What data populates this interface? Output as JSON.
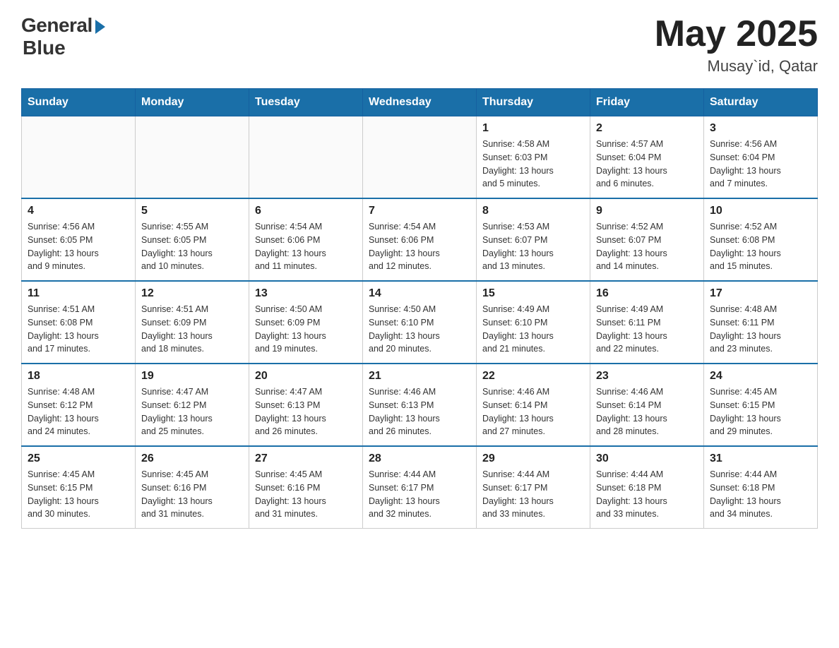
{
  "header": {
    "logo_general": "General",
    "logo_blue": "Blue",
    "main_title": "May 2025",
    "subtitle": "Musay`id, Qatar"
  },
  "days_of_week": [
    "Sunday",
    "Monday",
    "Tuesday",
    "Wednesday",
    "Thursday",
    "Friday",
    "Saturday"
  ],
  "weeks": [
    [
      {
        "num": "",
        "info": ""
      },
      {
        "num": "",
        "info": ""
      },
      {
        "num": "",
        "info": ""
      },
      {
        "num": "",
        "info": ""
      },
      {
        "num": "1",
        "info": "Sunrise: 4:58 AM\nSunset: 6:03 PM\nDaylight: 13 hours\nand 5 minutes."
      },
      {
        "num": "2",
        "info": "Sunrise: 4:57 AM\nSunset: 6:04 PM\nDaylight: 13 hours\nand 6 minutes."
      },
      {
        "num": "3",
        "info": "Sunrise: 4:56 AM\nSunset: 6:04 PM\nDaylight: 13 hours\nand 7 minutes."
      }
    ],
    [
      {
        "num": "4",
        "info": "Sunrise: 4:56 AM\nSunset: 6:05 PM\nDaylight: 13 hours\nand 9 minutes."
      },
      {
        "num": "5",
        "info": "Sunrise: 4:55 AM\nSunset: 6:05 PM\nDaylight: 13 hours\nand 10 minutes."
      },
      {
        "num": "6",
        "info": "Sunrise: 4:54 AM\nSunset: 6:06 PM\nDaylight: 13 hours\nand 11 minutes."
      },
      {
        "num": "7",
        "info": "Sunrise: 4:54 AM\nSunset: 6:06 PM\nDaylight: 13 hours\nand 12 minutes."
      },
      {
        "num": "8",
        "info": "Sunrise: 4:53 AM\nSunset: 6:07 PM\nDaylight: 13 hours\nand 13 minutes."
      },
      {
        "num": "9",
        "info": "Sunrise: 4:52 AM\nSunset: 6:07 PM\nDaylight: 13 hours\nand 14 minutes."
      },
      {
        "num": "10",
        "info": "Sunrise: 4:52 AM\nSunset: 6:08 PM\nDaylight: 13 hours\nand 15 minutes."
      }
    ],
    [
      {
        "num": "11",
        "info": "Sunrise: 4:51 AM\nSunset: 6:08 PM\nDaylight: 13 hours\nand 17 minutes."
      },
      {
        "num": "12",
        "info": "Sunrise: 4:51 AM\nSunset: 6:09 PM\nDaylight: 13 hours\nand 18 minutes."
      },
      {
        "num": "13",
        "info": "Sunrise: 4:50 AM\nSunset: 6:09 PM\nDaylight: 13 hours\nand 19 minutes."
      },
      {
        "num": "14",
        "info": "Sunrise: 4:50 AM\nSunset: 6:10 PM\nDaylight: 13 hours\nand 20 minutes."
      },
      {
        "num": "15",
        "info": "Sunrise: 4:49 AM\nSunset: 6:10 PM\nDaylight: 13 hours\nand 21 minutes."
      },
      {
        "num": "16",
        "info": "Sunrise: 4:49 AM\nSunset: 6:11 PM\nDaylight: 13 hours\nand 22 minutes."
      },
      {
        "num": "17",
        "info": "Sunrise: 4:48 AM\nSunset: 6:11 PM\nDaylight: 13 hours\nand 23 minutes."
      }
    ],
    [
      {
        "num": "18",
        "info": "Sunrise: 4:48 AM\nSunset: 6:12 PM\nDaylight: 13 hours\nand 24 minutes."
      },
      {
        "num": "19",
        "info": "Sunrise: 4:47 AM\nSunset: 6:12 PM\nDaylight: 13 hours\nand 25 minutes."
      },
      {
        "num": "20",
        "info": "Sunrise: 4:47 AM\nSunset: 6:13 PM\nDaylight: 13 hours\nand 26 minutes."
      },
      {
        "num": "21",
        "info": "Sunrise: 4:46 AM\nSunset: 6:13 PM\nDaylight: 13 hours\nand 26 minutes."
      },
      {
        "num": "22",
        "info": "Sunrise: 4:46 AM\nSunset: 6:14 PM\nDaylight: 13 hours\nand 27 minutes."
      },
      {
        "num": "23",
        "info": "Sunrise: 4:46 AM\nSunset: 6:14 PM\nDaylight: 13 hours\nand 28 minutes."
      },
      {
        "num": "24",
        "info": "Sunrise: 4:45 AM\nSunset: 6:15 PM\nDaylight: 13 hours\nand 29 minutes."
      }
    ],
    [
      {
        "num": "25",
        "info": "Sunrise: 4:45 AM\nSunset: 6:15 PM\nDaylight: 13 hours\nand 30 minutes."
      },
      {
        "num": "26",
        "info": "Sunrise: 4:45 AM\nSunset: 6:16 PM\nDaylight: 13 hours\nand 31 minutes."
      },
      {
        "num": "27",
        "info": "Sunrise: 4:45 AM\nSunset: 6:16 PM\nDaylight: 13 hours\nand 31 minutes."
      },
      {
        "num": "28",
        "info": "Sunrise: 4:44 AM\nSunset: 6:17 PM\nDaylight: 13 hours\nand 32 minutes."
      },
      {
        "num": "29",
        "info": "Sunrise: 4:44 AM\nSunset: 6:17 PM\nDaylight: 13 hours\nand 33 minutes."
      },
      {
        "num": "30",
        "info": "Sunrise: 4:44 AM\nSunset: 6:18 PM\nDaylight: 13 hours\nand 33 minutes."
      },
      {
        "num": "31",
        "info": "Sunrise: 4:44 AM\nSunset: 6:18 PM\nDaylight: 13 hours\nand 34 minutes."
      }
    ]
  ]
}
